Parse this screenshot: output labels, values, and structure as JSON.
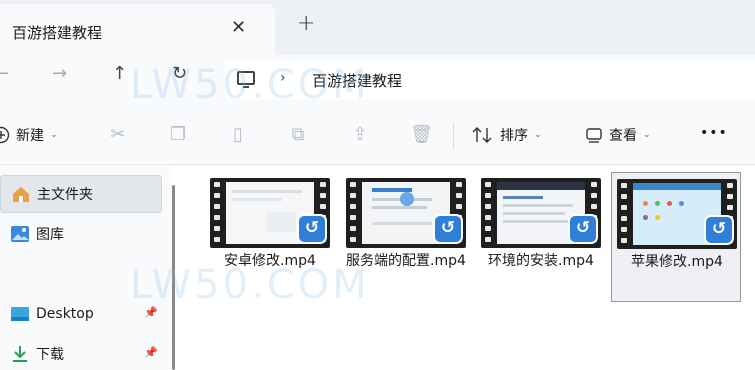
{
  "tab": {
    "title": "百游搭建教程",
    "close": "✕",
    "new_tab": "+"
  },
  "nav": {
    "back": "←",
    "forward": "→",
    "up": "↑",
    "refresh": "↻"
  },
  "address": {
    "chevron": "›",
    "path": "百游搭建教程"
  },
  "commands": {
    "new_label": "新建",
    "sort_label": "排序",
    "view_label": "查看",
    "more_label": "•••",
    "caret": "⌄"
  },
  "sidebar": {
    "items": [
      {
        "label": "主文件夹",
        "icon": "home-icon"
      },
      {
        "label": "图库",
        "icon": "gallery-icon"
      },
      {
        "label": "Desktop",
        "icon": "desktop-icon",
        "pinned": true
      },
      {
        "label": "下载",
        "icon": "download-icon",
        "pinned": true
      }
    ]
  },
  "files": [
    {
      "name": "安卓修改.mp4",
      "icon": "video-file-icon"
    },
    {
      "name": "服务端的配置.mp4",
      "icon": "video-file-icon"
    },
    {
      "name": "环境的安装.mp4",
      "icon": "video-file-icon"
    },
    {
      "name": "苹果修改.mp4",
      "icon": "video-file-icon",
      "selected": true
    }
  ],
  "watermark": "LW50.COM",
  "colors": {
    "accent": "#2f7fd8",
    "folder": "#f2c14b",
    "tabbar": "#edf1f6",
    "selection": "#e3e6ea"
  }
}
